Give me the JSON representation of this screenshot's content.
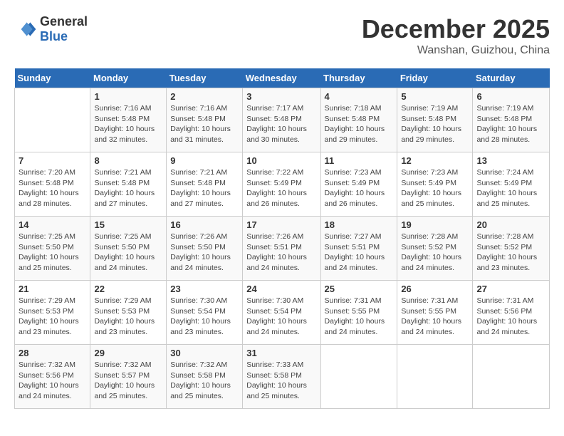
{
  "header": {
    "logo_general": "General",
    "logo_blue": "Blue",
    "month_title": "December 2025",
    "location": "Wanshan, Guizhou, China"
  },
  "days_of_week": [
    "Sunday",
    "Monday",
    "Tuesday",
    "Wednesday",
    "Thursday",
    "Friday",
    "Saturday"
  ],
  "weeks": [
    [
      {
        "day": "",
        "detail": ""
      },
      {
        "day": "1",
        "detail": "Sunrise: 7:16 AM\nSunset: 5:48 PM\nDaylight: 10 hours\nand 32 minutes."
      },
      {
        "day": "2",
        "detail": "Sunrise: 7:16 AM\nSunset: 5:48 PM\nDaylight: 10 hours\nand 31 minutes."
      },
      {
        "day": "3",
        "detail": "Sunrise: 7:17 AM\nSunset: 5:48 PM\nDaylight: 10 hours\nand 30 minutes."
      },
      {
        "day": "4",
        "detail": "Sunrise: 7:18 AM\nSunset: 5:48 PM\nDaylight: 10 hours\nand 29 minutes."
      },
      {
        "day": "5",
        "detail": "Sunrise: 7:19 AM\nSunset: 5:48 PM\nDaylight: 10 hours\nand 29 minutes."
      },
      {
        "day": "6",
        "detail": "Sunrise: 7:19 AM\nSunset: 5:48 PM\nDaylight: 10 hours\nand 28 minutes."
      }
    ],
    [
      {
        "day": "7",
        "detail": "Sunrise: 7:20 AM\nSunset: 5:48 PM\nDaylight: 10 hours\nand 28 minutes."
      },
      {
        "day": "8",
        "detail": "Sunrise: 7:21 AM\nSunset: 5:48 PM\nDaylight: 10 hours\nand 27 minutes."
      },
      {
        "day": "9",
        "detail": "Sunrise: 7:21 AM\nSunset: 5:48 PM\nDaylight: 10 hours\nand 27 minutes."
      },
      {
        "day": "10",
        "detail": "Sunrise: 7:22 AM\nSunset: 5:49 PM\nDaylight: 10 hours\nand 26 minutes."
      },
      {
        "day": "11",
        "detail": "Sunrise: 7:23 AM\nSunset: 5:49 PM\nDaylight: 10 hours\nand 26 minutes."
      },
      {
        "day": "12",
        "detail": "Sunrise: 7:23 AM\nSunset: 5:49 PM\nDaylight: 10 hours\nand 25 minutes."
      },
      {
        "day": "13",
        "detail": "Sunrise: 7:24 AM\nSunset: 5:49 PM\nDaylight: 10 hours\nand 25 minutes."
      }
    ],
    [
      {
        "day": "14",
        "detail": "Sunrise: 7:25 AM\nSunset: 5:50 PM\nDaylight: 10 hours\nand 25 minutes."
      },
      {
        "day": "15",
        "detail": "Sunrise: 7:25 AM\nSunset: 5:50 PM\nDaylight: 10 hours\nand 24 minutes."
      },
      {
        "day": "16",
        "detail": "Sunrise: 7:26 AM\nSunset: 5:50 PM\nDaylight: 10 hours\nand 24 minutes."
      },
      {
        "day": "17",
        "detail": "Sunrise: 7:26 AM\nSunset: 5:51 PM\nDaylight: 10 hours\nand 24 minutes."
      },
      {
        "day": "18",
        "detail": "Sunrise: 7:27 AM\nSunset: 5:51 PM\nDaylight: 10 hours\nand 24 minutes."
      },
      {
        "day": "19",
        "detail": "Sunrise: 7:28 AM\nSunset: 5:52 PM\nDaylight: 10 hours\nand 24 minutes."
      },
      {
        "day": "20",
        "detail": "Sunrise: 7:28 AM\nSunset: 5:52 PM\nDaylight: 10 hours\nand 23 minutes."
      }
    ],
    [
      {
        "day": "21",
        "detail": "Sunrise: 7:29 AM\nSunset: 5:53 PM\nDaylight: 10 hours\nand 23 minutes."
      },
      {
        "day": "22",
        "detail": "Sunrise: 7:29 AM\nSunset: 5:53 PM\nDaylight: 10 hours\nand 23 minutes."
      },
      {
        "day": "23",
        "detail": "Sunrise: 7:30 AM\nSunset: 5:54 PM\nDaylight: 10 hours\nand 23 minutes."
      },
      {
        "day": "24",
        "detail": "Sunrise: 7:30 AM\nSunset: 5:54 PM\nDaylight: 10 hours\nand 24 minutes."
      },
      {
        "day": "25",
        "detail": "Sunrise: 7:31 AM\nSunset: 5:55 PM\nDaylight: 10 hours\nand 24 minutes."
      },
      {
        "day": "26",
        "detail": "Sunrise: 7:31 AM\nSunset: 5:55 PM\nDaylight: 10 hours\nand 24 minutes."
      },
      {
        "day": "27",
        "detail": "Sunrise: 7:31 AM\nSunset: 5:56 PM\nDaylight: 10 hours\nand 24 minutes."
      }
    ],
    [
      {
        "day": "28",
        "detail": "Sunrise: 7:32 AM\nSunset: 5:56 PM\nDaylight: 10 hours\nand 24 minutes."
      },
      {
        "day": "29",
        "detail": "Sunrise: 7:32 AM\nSunset: 5:57 PM\nDaylight: 10 hours\nand 25 minutes."
      },
      {
        "day": "30",
        "detail": "Sunrise: 7:32 AM\nSunset: 5:58 PM\nDaylight: 10 hours\nand 25 minutes."
      },
      {
        "day": "31",
        "detail": "Sunrise: 7:33 AM\nSunset: 5:58 PM\nDaylight: 10 hours\nand 25 minutes."
      },
      {
        "day": "",
        "detail": ""
      },
      {
        "day": "",
        "detail": ""
      },
      {
        "day": "",
        "detail": ""
      }
    ]
  ]
}
